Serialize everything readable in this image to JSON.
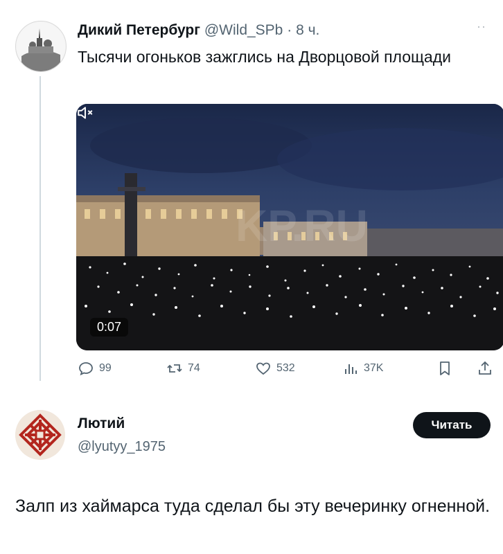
{
  "tweet": {
    "author_name": "Дикий Петербург",
    "handle": "@Wild_SPb",
    "separator": "·",
    "time": "8 ч.",
    "text": "Тысячи огоньков зажглись на Дворцовой площади",
    "more": "··"
  },
  "video": {
    "duration": "0:07",
    "watermark": "KP.RU"
  },
  "actions": {
    "replies": "99",
    "retweets": "74",
    "likes": "532",
    "views": "37K"
  },
  "reply": {
    "author_name": "Лютий",
    "handle": "@lyutyy_1975",
    "follow_label": "Читать",
    "text": "Залп из хаймарса туда сделал бы эту вечеринку огненной."
  },
  "colors": {
    "text_primary": "#0f1419",
    "text_secondary": "#536471",
    "thread_line": "#cfd9de",
    "ornament_red": "#b3261e"
  },
  "icons": [
    "reply-icon",
    "retweet-icon",
    "like-icon",
    "views-icon",
    "bookmark-icon",
    "share-icon",
    "mute-icon"
  ]
}
